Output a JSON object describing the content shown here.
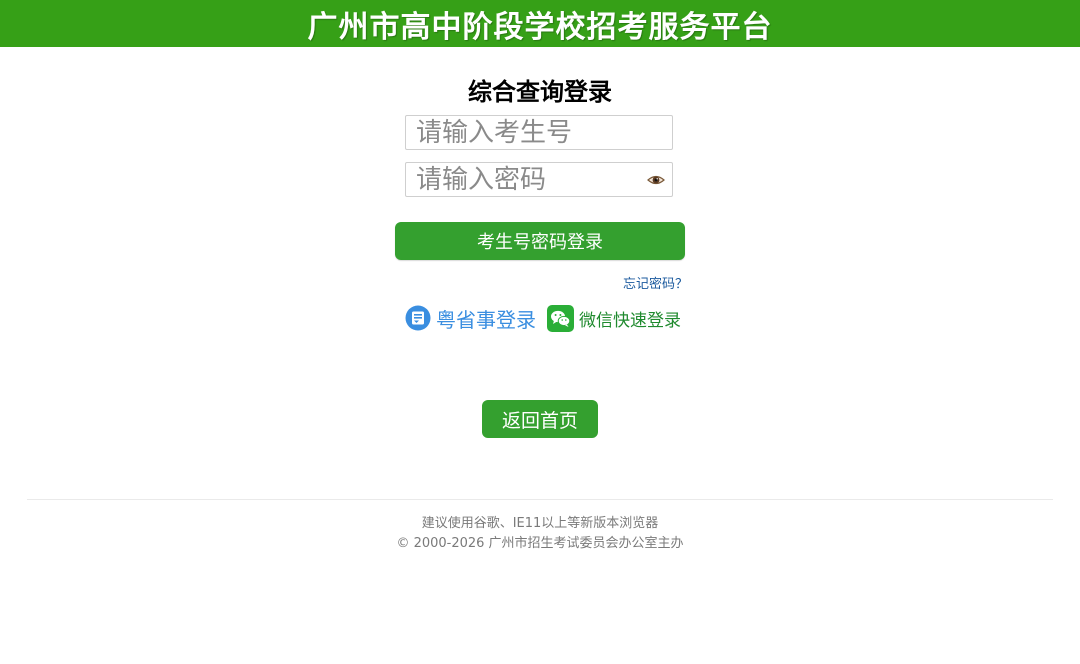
{
  "header": {
    "title": "广州市高中阶段学校招考服务平台"
  },
  "login": {
    "title": "综合查询登录",
    "username_placeholder": "请输入考生号",
    "password_placeholder": "请输入密码",
    "submit_label": "考生号密码登录",
    "forgot_label": "忘记密码？"
  },
  "alt_logins": {
    "yss_label": "粤省事登录",
    "wechat_label": "微信快速登录"
  },
  "actions": {
    "home_label": "返回首页"
  },
  "footer": {
    "browser_note": "建议使用谷歌、IE11以上等新版本浏览器",
    "copyright": "© 2000-2026 广州市招生考试委员会办公室主办"
  },
  "icons": {
    "eye": "eye-icon",
    "yss": "yueshengshi-icon",
    "wechat": "wechat-icon"
  },
  "colors": {
    "brand_green": "#36a017",
    "button_green": "#34a02f",
    "link_blue": "#1b5a9e",
    "yss_blue": "#3a8ee0",
    "wechat_green": "#1f8a2e"
  }
}
